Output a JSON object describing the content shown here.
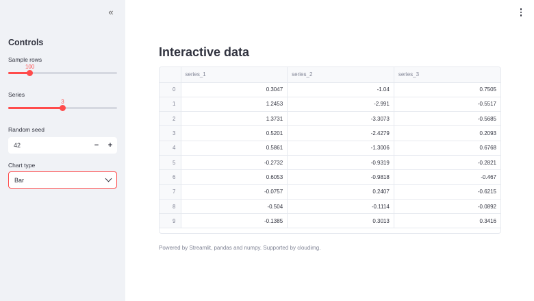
{
  "sidebar": {
    "collapse_icon": "«",
    "title": "Controls",
    "sample_rows": {
      "label": "Sample rows",
      "value": "100",
      "fraction": 0.199
    },
    "series": {
      "label": "Series",
      "value": "3",
      "fraction": 0.5
    },
    "random_seed": {
      "label": "Random seed",
      "value": "42",
      "minus": "−",
      "plus": "+"
    },
    "chart_type": {
      "label": "Chart type",
      "value": "Bar"
    }
  },
  "main": {
    "title": "Interactive data",
    "table": {
      "columns": [
        "",
        "series_1",
        "series_2",
        "series_3"
      ],
      "rows": [
        [
          "0",
          "0.3047",
          "-1.04",
          "0.7505"
        ],
        [
          "1",
          "1.2453",
          "-2.991",
          "-0.5517"
        ],
        [
          "2",
          "1.3731",
          "-3.3073",
          "-0.5685"
        ],
        [
          "3",
          "0.5201",
          "-2.4279",
          "0.2093"
        ],
        [
          "4",
          "0.5861",
          "-1.3006",
          "0.6768"
        ],
        [
          "5",
          "-0.2732",
          "-0.9319",
          "-0.2821"
        ],
        [
          "6",
          "0.6053",
          "-0.9818",
          "-0.467"
        ],
        [
          "7",
          "-0.0757",
          "0.2407",
          "-0.6215"
        ],
        [
          "8",
          "-0.504",
          "-0.1114",
          "-0.0892"
        ],
        [
          "9",
          "-0.1385",
          "0.3013",
          "0.3416"
        ]
      ]
    },
    "footer": "Powered by Streamlit, pandas and numpy. Supported by cloudimg."
  },
  "colors": {
    "accent": "#ff4b4b",
    "sidebar_bg": "#f0f2f6",
    "text": "#31333f",
    "muted": "#808495"
  }
}
